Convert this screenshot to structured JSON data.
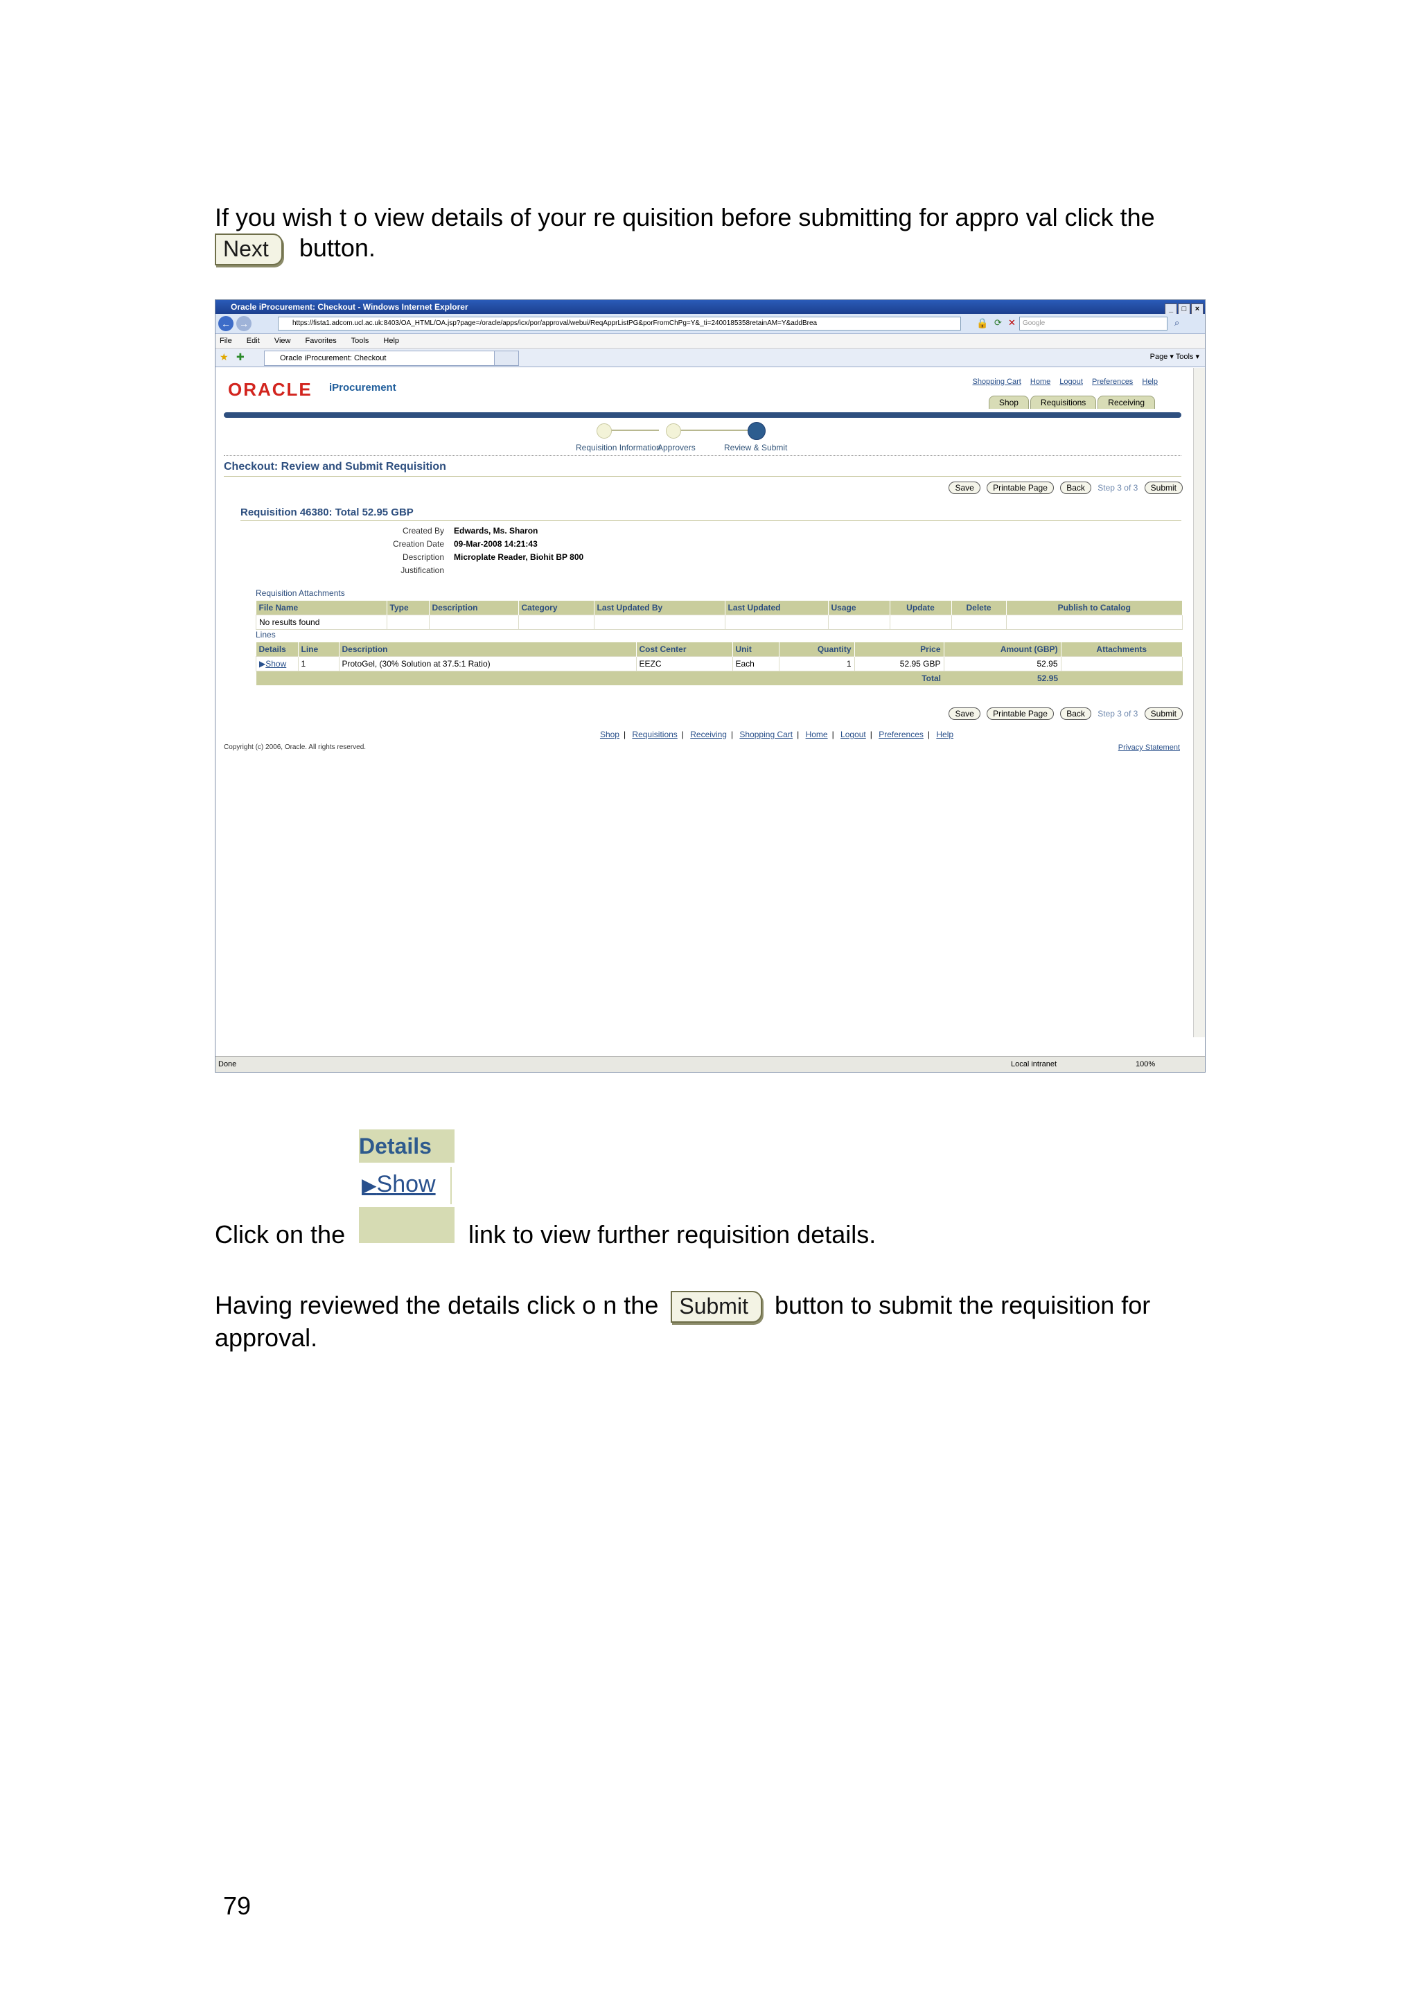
{
  "doc": {
    "para1_a": "If you wish t o view details of your re quisition before submitting for appro val click the",
    "para1_b": "button.",
    "next_label": "Next",
    "para2_a": "Click on the",
    "para2_b": "link to view further requisition details.",
    "para3_a": "Having reviewed the details click o n the",
    "para3_b": "button to submit the requisition for",
    "para3_c": "approval.",
    "submit_label": "Submit",
    "page_number": "79"
  },
  "snippet": {
    "header": "Details",
    "link": "Show"
  },
  "browser": {
    "title": "Oracle iProcurement: Checkout - Windows Internet Explorer",
    "url": "https://fista1.adcom.ucl.ac.uk:8403/OA_HTML/OA.jsp?page=/oracle/apps/icx/por/approval/webui/ReqApprListPG&porFromChPg=Y&_ti=2400185358retainAM=Y&addBrea",
    "search_placeholder": "Google",
    "menu": [
      "File",
      "Edit",
      "View",
      "Favorites",
      "Tools",
      "Help"
    ],
    "tab_title": "Oracle iProcurement: Checkout",
    "toolbar_right": "Page ▾   Tools ▾",
    "status_left": "Done",
    "status_zone": "Local intranet",
    "zoom": "100%"
  },
  "app": {
    "logo": "ORACLE",
    "name": "iProcurement",
    "global_links": [
      "Shopping Cart",
      "Home",
      "Logout",
      "Preferences",
      "Help"
    ],
    "tabs": [
      "Shop",
      "Requisitions",
      "Receiving"
    ],
    "train": [
      "Requisition Information",
      "Approvers",
      "Review & Submit"
    ],
    "page_title": "Checkout: Review and Submit Requisition",
    "buttons": {
      "save": "Save",
      "printable": "Printable Page",
      "back": "Back",
      "step": "Step 3 of 3",
      "submit": "Submit"
    },
    "req_header": "Requisition 46380: Total 52.95 GBP",
    "fields": [
      {
        "k": "Created By",
        "v": "Edwards, Ms. Sharon"
      },
      {
        "k": "Creation Date",
        "v": "09-Mar-2008 14:21:43"
      },
      {
        "k": "Description",
        "v": "Microplate Reader, Biohit BP 800"
      },
      {
        "k": "Justification",
        "v": ""
      }
    ],
    "attachments_title": "Requisition Attachments",
    "attachments_cols": [
      "File Name",
      "Type",
      "Description",
      "Category",
      "Last Updated By",
      "Last Updated",
      "Usage",
      "Update",
      "Delete",
      "Publish to Catalog"
    ],
    "attachments_empty": "No results found",
    "lines_title": "Lines",
    "lines_cols": [
      "Details",
      "Line",
      "Description",
      "Cost Center",
      "Unit",
      "Quantity",
      "Price",
      "Amount (GBP)",
      "Attachments"
    ],
    "lines_rows": [
      {
        "details": "Show",
        "line": "1",
        "description": "ProtoGel, (30% Solution at 37.5:1 Ratio)",
        "cost_center": "EEZC",
        "unit": "Each",
        "quantity": "1",
        "price": "52.95 GBP",
        "amount": "52.95",
        "attachments": ""
      }
    ],
    "total_label": "Total",
    "total_value": "52.95",
    "footer_links": [
      "Shop",
      "Requisitions",
      "Receiving",
      "Shopping Cart",
      "Home",
      "Logout",
      "Preferences",
      "Help"
    ],
    "copyright": "Copyright (c) 2006, Oracle. All rights reserved.",
    "privacy": "Privacy Statement"
  }
}
